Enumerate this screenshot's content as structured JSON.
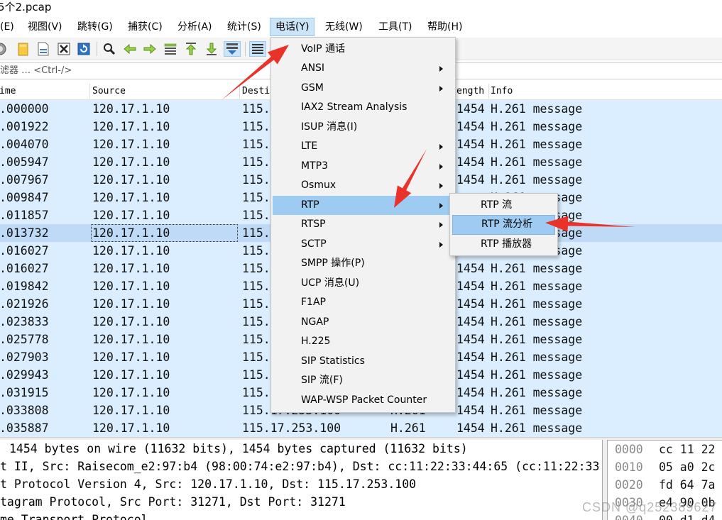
{
  "window": {
    "title": "5个2.pcap"
  },
  "menubar": {
    "edit": "(E)",
    "view": "视图(V)",
    "go": "跳转(G)",
    "capture": "捕获(C)",
    "analyze": "分析(A)",
    "statistics": "统计(S)",
    "telephony": "电话(Y)",
    "wireless": "无线(W)",
    "tools": "工具(T)",
    "help": "帮助(H)"
  },
  "toolbar": {
    "icons": [
      "capture-options-icon",
      "open-file-icon",
      "save-file-icon",
      "close-file-icon",
      "reload-icon",
      "find-packet-icon",
      "go-back-icon",
      "go-forward-icon",
      "go-to-packet-icon",
      "first-packet-icon",
      "last-packet-icon",
      "autoscroll-icon",
      "colorize-icon"
    ]
  },
  "filter": {
    "text": "滤器 … <Ctrl-/>"
  },
  "packet_list": {
    "columns": {
      "time": "ime",
      "source": "Source",
      "destination": "Desti",
      "length": "ength",
      "info": "Info"
    },
    "selected_index": 7,
    "rows": [
      {
        "time": ".000000",
        "source": "120.17.1.10",
        "destination": "115.",
        "protocol": "",
        "length": "1454",
        "info": "H.261 message"
      },
      {
        "time": ".001922",
        "source": "120.17.1.10",
        "destination": "115.",
        "protocol": "",
        "length": "1454",
        "info": "H.261 message"
      },
      {
        "time": ".004070",
        "source": "120.17.1.10",
        "destination": "115.",
        "protocol": "",
        "length": "1454",
        "info": "H.261 message"
      },
      {
        "time": ".005947",
        "source": "120.17.1.10",
        "destination": "115.",
        "protocol": "",
        "length": "1454",
        "info": "H.261 message"
      },
      {
        "time": ".007967",
        "source": "120.17.1.10",
        "destination": "115.",
        "protocol": "",
        "length": "1454",
        "info": "H.261 message"
      },
      {
        "time": ".009847",
        "source": "120.17.1.10",
        "destination": "115.",
        "protocol": "",
        "length": "",
        "info": "H.261 message"
      },
      {
        "time": ".011857",
        "source": "120.17.1.10",
        "destination": "115.",
        "protocol": "",
        "length": "",
        "info": "H.261 message"
      },
      {
        "time": ".013732",
        "source": "120.17.1.10",
        "destination": "115.",
        "protocol": "",
        "length": "",
        "info": "H.261 message"
      },
      {
        "time": ".016027",
        "source": "120.17.1.10",
        "destination": "115.",
        "protocol": "",
        "length": "",
        "info": "H.261 message"
      },
      {
        "time": ".016027",
        "source": "120.17.1.10",
        "destination": "115.",
        "protocol": "",
        "length": "1454",
        "info": "H.261 message"
      },
      {
        "time": ".019842",
        "source": "120.17.1.10",
        "destination": "115.",
        "protocol": "",
        "length": "1454",
        "info": "H.261 message"
      },
      {
        "time": ".021926",
        "source": "120.17.1.10",
        "destination": "115.",
        "protocol": "",
        "length": "1454",
        "info": "H.261 message"
      },
      {
        "time": ".023833",
        "source": "120.17.1.10",
        "destination": "115.",
        "protocol": "",
        "length": "1454",
        "info": "H.261 message"
      },
      {
        "time": ".025778",
        "source": "120.17.1.10",
        "destination": "115.",
        "protocol": "",
        "length": "1454",
        "info": "H.261 message"
      },
      {
        "time": ".027903",
        "source": "120.17.1.10",
        "destination": "115.",
        "protocol": "",
        "length": "1454",
        "info": "H.261 message"
      },
      {
        "time": ".029943",
        "source": "120.17.1.10",
        "destination": "115.",
        "protocol": "",
        "length": "1454",
        "info": "H.261 message"
      },
      {
        "time": ".031915",
        "source": "120.17.1.10",
        "destination": "115.",
        "protocol": "",
        "length": "1454",
        "info": "H.261 message"
      },
      {
        "time": ".033808",
        "source": "120.17.1.10",
        "destination": "115.17.253.100",
        "protocol": "H.261",
        "length": "1454",
        "info": "H.261 message"
      },
      {
        "time": ".035887",
        "source": "120.17.1.10",
        "destination": "115.17.253.100",
        "protocol": "H.261",
        "length": "1454",
        "info": "H.261 message"
      }
    ]
  },
  "details": {
    "lines": [
      "1454 bytes on wire (11632 bits), 1454 bytes captured (11632 bits)",
      "t II, Src: Raisecom_e2:97:b4 (98:00:74:e2:97:b4), Dst: cc:11:22:33:44:65 (cc:11:22:33:",
      "t Protocol Version 4, Src: 120.17.1.10, Dst: 115.17.253.100",
      "tagram Protocol, Src Port: 31271, Dst Port: 31271",
      "me Transport Protocol"
    ]
  },
  "hex": {
    "rows": [
      {
        "offset": "0000",
        "bytes": "cc 11 22"
      },
      {
        "offset": "0010",
        "bytes": "05 a0 2c"
      },
      {
        "offset": "0020",
        "bytes": "fd 64 7a"
      },
      {
        "offset": "0030",
        "bytes": "e4 90 0b"
      },
      {
        "offset": "0040",
        "bytes": "00 d1 d4"
      }
    ]
  },
  "telephony_menu": {
    "highlighted_index": 8,
    "items": [
      {
        "label": "VoIP 通话",
        "submenu": false
      },
      {
        "label": "ANSI",
        "submenu": true
      },
      {
        "label": "GSM",
        "submenu": true
      },
      {
        "label": "IAX2 Stream Analysis",
        "submenu": false
      },
      {
        "label": "ISUP 消息(I)",
        "submenu": false
      },
      {
        "label": "LTE",
        "submenu": true
      },
      {
        "label": "MTP3",
        "submenu": true
      },
      {
        "label": "Osmux",
        "submenu": true
      },
      {
        "label": "RTP",
        "submenu": true
      },
      {
        "label": "RTSP",
        "submenu": true
      },
      {
        "label": "SCTP",
        "submenu": true
      },
      {
        "label": "SMPP 操作(P)",
        "submenu": false
      },
      {
        "label": "UCP 消息(U)",
        "submenu": false
      },
      {
        "label": "F1AP",
        "submenu": false
      },
      {
        "label": "NGAP",
        "submenu": false
      },
      {
        "label": "H.225",
        "submenu": false
      },
      {
        "label": "SIP Statistics",
        "submenu": false
      },
      {
        "label": "SIP 流(F)",
        "submenu": false
      },
      {
        "label": "WAP-WSP Packet Counter",
        "submenu": false
      }
    ]
  },
  "rtp_submenu": {
    "highlighted_index": 1,
    "items": [
      "RTP 流",
      "RTP 流分析",
      "RTP 播放器"
    ]
  },
  "watermark": "CSDN @q252389627",
  "colors": {
    "row_bg": "#daeeff",
    "selected_row_bg": "#bfdaf6",
    "menu_highlight": "#9dcbf1",
    "menubar_active": "#cce4f7",
    "annotation_arrow": "#e8322a"
  }
}
